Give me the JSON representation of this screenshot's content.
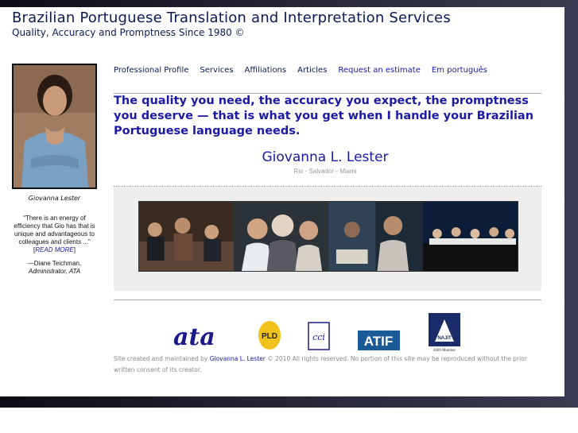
{
  "site": {
    "title": "Brazilian Portuguese Translation and Interpretation Services",
    "subtitle": "Quality, Accuracy and Promptness Since 1980 ©"
  },
  "sidebar": {
    "photo_caption": "Giovanna Lester",
    "quote": "“There is an energy of efficiency that Gio has that is unique and advantageous to colleagues and clients ...”",
    "read_more_open": "[",
    "read_more_label": "READ MORE",
    "read_more_close": "]",
    "author_name": "—Diane Teichman,",
    "author_title": "Administrator, ATA"
  },
  "nav": {
    "items": [
      {
        "label": "Professional Profile"
      },
      {
        "label": "Services"
      },
      {
        "label": "Affiliations"
      },
      {
        "label": "Articles"
      },
      {
        "label": "Request an estimate"
      },
      {
        "label": "Em português"
      }
    ]
  },
  "main": {
    "tagline": "The quality you need, the accuracy you expect, the promptness you deserve — that is what you get when I handle your Brazilian Portuguese language needs.",
    "name": "Giovanna L. Lester",
    "locations": "Rio - Salvador - Miami"
  },
  "logos": [
    {
      "label": "ata",
      "icon": "ata-logo"
    },
    {
      "label": "PLD",
      "icon": "pld-logo"
    },
    {
      "label": "cci",
      "icon": "cci-logo"
    },
    {
      "label": "ATIF",
      "icon": "atif-logo"
    },
    {
      "label": "NAJIT",
      "sublabel": "2009 Member",
      "icon": "najit-logo"
    }
  ],
  "footer": {
    "prefix": "Site created and maintained by ",
    "name": "Giovanna L. Lester",
    "suffix": " © 2010 All rights reserved. No portion of this site may be reproduced without the prior written consent of its creator."
  },
  "colors": {
    "title": "#0a1a55",
    "accent": "#1a1aa6",
    "background_dark": "#1c1c2a"
  }
}
